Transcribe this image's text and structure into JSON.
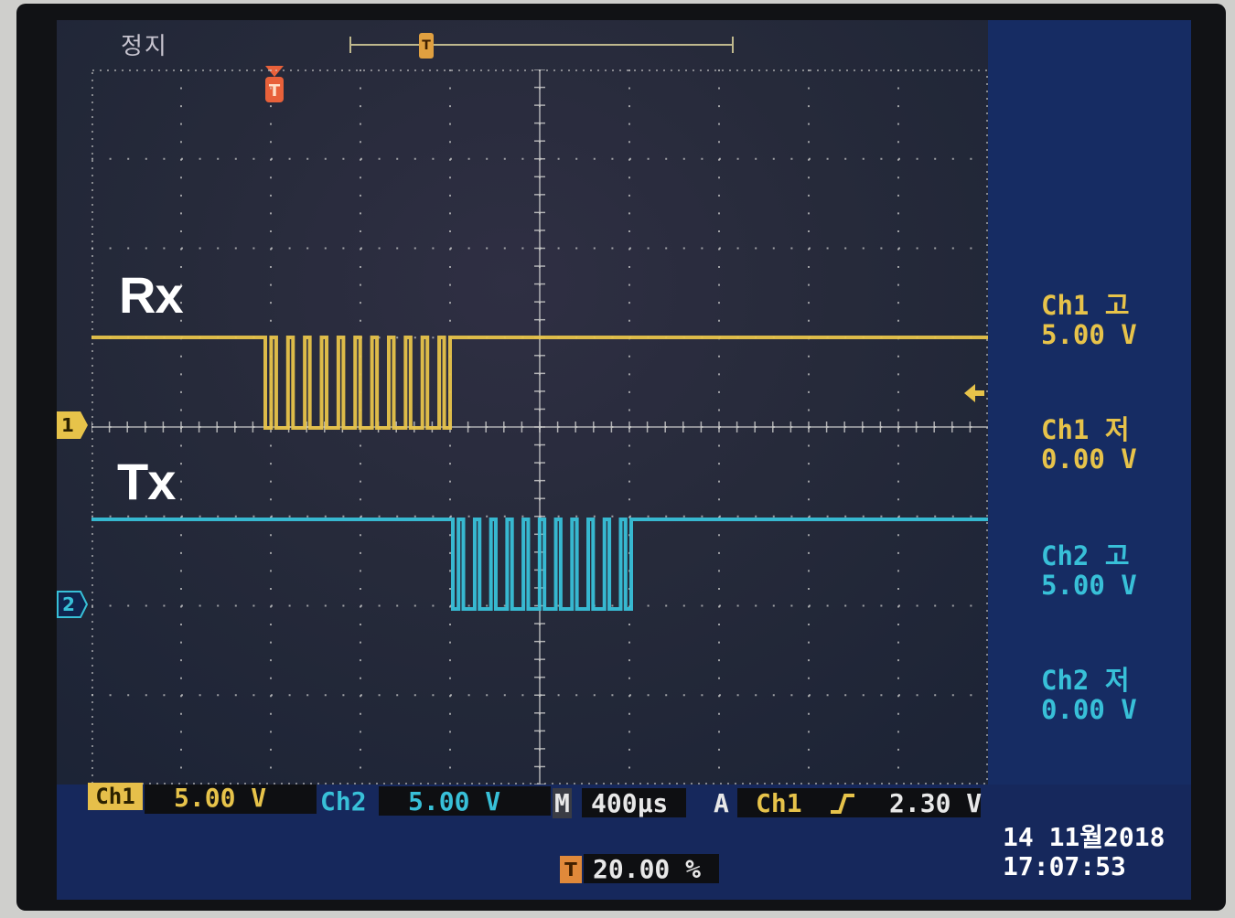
{
  "status": "정지",
  "signal_labels": {
    "rx": "Rx",
    "tx": "Tx"
  },
  "ch_markers": {
    "ch1": "1",
    "ch2": "2"
  },
  "trigger_marker": "T",
  "right_panel": {
    "ch1_high": {
      "label": "Ch1 고",
      "value": "5.00 V"
    },
    "ch1_low": {
      "label": "Ch1 저",
      "value": "0.00 V"
    },
    "ch2_high": {
      "label": "Ch2 고",
      "value": "5.00 V"
    },
    "ch2_low": {
      "label": "Ch2 저",
      "value": "0.00 V"
    }
  },
  "bottom": {
    "ch1_tag": "Ch1",
    "ch1_scale": "5.00 V",
    "ch2_tag": "Ch2",
    "ch2_scale": "5.00 V",
    "time_tag": "M",
    "time_scale": "400µs",
    "trig_tag": "A",
    "trig_source": "Ch1",
    "trig_slope": "rising-edge-icon",
    "trig_level": "2.30 V",
    "trig_pos_tag": "T",
    "trig_pos": "20.00 %"
  },
  "datetime": {
    "date": "14 11월2018",
    "time": "17:07:53"
  },
  "colors": {
    "ch1": "#e7c34a",
    "ch2": "#38c0d8",
    "grid": "#c8c8c8",
    "panel": "#162c63"
  }
}
